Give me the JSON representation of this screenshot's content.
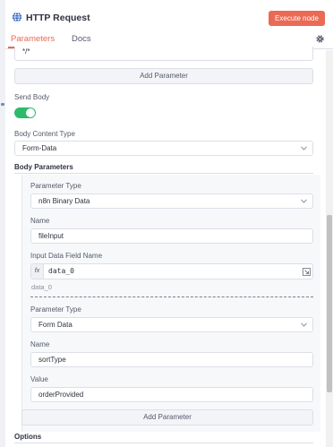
{
  "header": {
    "title": "HTTP Request",
    "execute_label": "Execute node"
  },
  "tabs": [
    {
      "label": "Parameters",
      "active": true
    },
    {
      "label": "Docs",
      "active": false
    }
  ],
  "top_field": {
    "value": "*/*"
  },
  "add_parameter_label": "Add Parameter",
  "send_body": {
    "label": "Send Body",
    "enabled": true
  },
  "body_content_type": {
    "label": "Body Content Type",
    "value": "Form-Data"
  },
  "body_parameters": {
    "title": "Body Parameters",
    "items": [
      {
        "parameter_type_label": "Parameter Type",
        "parameter_type": "n8n Binary Data",
        "name_label": "Name",
        "name": "fileInput",
        "input_field_label": "Input Data Field Name",
        "fx": "fx",
        "input_field_value": "data_0",
        "input_field_preview": "data_0"
      },
      {
        "parameter_type_label": "Parameter Type",
        "parameter_type": "Form Data",
        "name_label": "Name",
        "name": "sortType",
        "value_label": "Value",
        "value": "orderProvided"
      }
    ],
    "add_parameter_label": "Add Parameter"
  },
  "options": {
    "title": "Options"
  },
  "colors": {
    "accent": "#ea6a54",
    "toggle_on": "#2cbb6a",
    "border": "#dcdfe6"
  },
  "icons": [
    "globe-icon",
    "gear-icon",
    "chevron-down-icon",
    "expand-icon"
  ]
}
